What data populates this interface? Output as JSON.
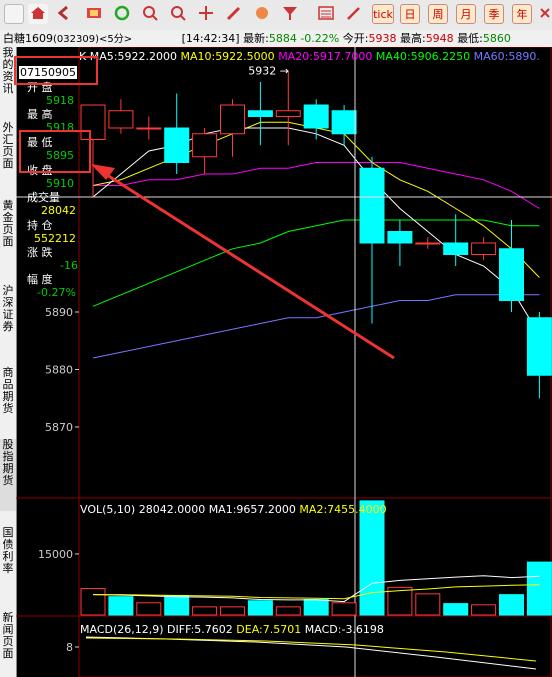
{
  "toolbar": {
    "icons": [
      "home-icon",
      "back-icon",
      "forward-icon",
      "video-icon",
      "refresh-icon",
      "zoom-in-icon",
      "zoom-out-icon",
      "crosshair-icon",
      "pen-icon",
      "pie-icon",
      "filter-icon",
      "list-icon",
      "draw-icon",
      "vol-icon",
      "f10-icon",
      "tick-icon"
    ],
    "tabs": [
      "日",
      "周",
      "月",
      "季",
      "年"
    ]
  },
  "infobar": {
    "symbol": "白糖1609",
    "code": "(032309)",
    "period": "<5分>",
    "time": "[14:42:34]",
    "last_label": "最新:",
    "last_value": "5884",
    "change": "-0.22%",
    "open_label": "今开:",
    "open_value": "5938",
    "high_label": "最高:",
    "high_value": "5948",
    "low_label": "最低:",
    "low_value": "5860"
  },
  "sidebar": {
    "tabs": [
      "我的资讯",
      "外汇页面",
      "黄金页面",
      "沪深证券",
      "商品期货",
      "股指期货",
      "国债利率",
      "新闻页面"
    ]
  },
  "info_panel": {
    "date": "07150905",
    "rows": [
      {
        "name": "开 盘",
        "value": "5918"
      },
      {
        "name": "最 高",
        "value": "5918"
      },
      {
        "name": "最 低",
        "value": "5895"
      },
      {
        "name": "收 盘",
        "value": "5910"
      },
      {
        "name": "成交量",
        "value": "28042"
      },
      {
        "name": "持 仓",
        "value": "552212"
      },
      {
        "name": "涨 跌",
        "value": "-16"
      },
      {
        "name": "幅 度",
        "value": "-0.27%"
      }
    ]
  },
  "chart_data": [
    {
      "type": "candlestick",
      "title": "K",
      "legend": [
        {
          "name": "MA5",
          "value": "5922.2000",
          "color": "#ffffff"
        },
        {
          "name": "MA10",
          "value": "5922.5000",
          "color": "#ffff00"
        },
        {
          "name": "MA20",
          "value": "5917.7000",
          "color": "#ff00ff"
        },
        {
          "name": "MA40",
          "value": "5906.2250",
          "color": "#00ff00"
        },
        {
          "name": "MA60",
          "value": "5890.",
          "color": "#7777ff"
        }
      ],
      "ylim": [
        5855,
        5948
      ],
      "yticks": [
        5870,
        5880,
        5890
      ],
      "peak_label": "5932",
      "candles": [
        {
          "o": 5920,
          "c": 5926,
          "h": 5926,
          "l": 5910
        },
        {
          "o": 5922,
          "c": 5925,
          "h": 5927,
          "l": 5921
        },
        {
          "o": 5922,
          "c": 5922,
          "h": 5924,
          "l": 5920
        },
        {
          "o": 5922,
          "c": 5916,
          "h": 5928,
          "l": 5914
        },
        {
          "o": 5917,
          "c": 5921,
          "h": 5922,
          "l": 5914
        },
        {
          "o": 5921,
          "c": 5926,
          "h": 5927,
          "l": 5917
        },
        {
          "o": 5925,
          "c": 5924,
          "h": 5930,
          "l": 5919
        },
        {
          "o": 5924,
          "c": 5925,
          "h": 5932,
          "l": 5919
        },
        {
          "o": 5926,
          "c": 5922,
          "h": 5927,
          "l": 5920
        },
        {
          "o": 5925,
          "c": 5921,
          "h": 5926,
          "l": 5919
        },
        {
          "o": 5915,
          "c": 5902,
          "h": 5917,
          "l": 5888
        },
        {
          "o": 5904,
          "c": 5902,
          "h": 5906,
          "l": 5898
        },
        {
          "o": 5902,
          "c": 5902,
          "h": 5903,
          "l": 5901
        },
        {
          "o": 5902,
          "c": 5900,
          "h": 5907,
          "l": 5898
        },
        {
          "o": 5900,
          "c": 5902,
          "h": 5903,
          "l": 5899
        },
        {
          "o": 5901,
          "c": 5892,
          "h": 5906,
          "l": 5890
        },
        {
          "o": 5889,
          "c": 5879,
          "h": 5890,
          "l": 5875
        }
      ],
      "ma5": [
        5910,
        5914,
        5918,
        5919,
        5921,
        5922,
        5922,
        5922,
        5921,
        5919,
        5913,
        5908,
        5904,
        5900,
        5898,
        5894,
        5886
      ],
      "ma10": [
        5912,
        5913,
        5915,
        5917,
        5919,
        5921,
        5923,
        5923,
        5922,
        5921,
        5916,
        5913,
        5911,
        5908,
        5905,
        5901,
        5896
      ],
      "ma20": [
        5912,
        5912,
        5913,
        5913,
        5914,
        5914,
        5915,
        5915,
        5916,
        5916,
        5916,
        5916,
        5915,
        5914,
        5913,
        5911,
        5908
      ],
      "ma40": [
        5891,
        5893,
        5895,
        5897,
        5899,
        5901,
        5902,
        5904,
        5905,
        5906,
        5906,
        5906,
        5906,
        5906,
        5906,
        5905,
        5905
      ],
      "ma60": [
        5882,
        5883,
        5884,
        5885,
        5886,
        5887,
        5888,
        5889,
        5889,
        5890,
        5891,
        5892,
        5892,
        5893,
        5893,
        5893,
        5893
      ]
    },
    {
      "type": "bar",
      "title": "VOL(5,10)",
      "legend": [
        {
          "name": "VOL(5,10)",
          "value": "28042.0000",
          "color": "#ffffff"
        },
        {
          "name": "MA1",
          "value": "9657.2000",
          "color": "#ffffff"
        },
        {
          "name": "MA2",
          "value": "7455.4000",
          "color": "#ffff00"
        }
      ],
      "ylim": [
        0,
        28500
      ],
      "yticks": [
        15000
      ],
      "values": [
        6500,
        4500,
        3000,
        4800,
        2000,
        2000,
        3500,
        2000,
        3800,
        3000,
        28042,
        6800,
        5200,
        2800,
        2500,
        5000,
        13000
      ],
      "up": [
        true,
        false,
        true,
        false,
        true,
        true,
        false,
        true,
        false,
        true,
        false,
        true,
        true,
        false,
        true,
        false,
        false
      ],
      "ma1": [
        5000,
        4900,
        4700,
        4500,
        4400,
        4200,
        3800,
        3700,
        3700,
        3300,
        7800,
        8500,
        8900,
        9300,
        9657,
        9200,
        9500
      ],
      "ma2": [
        5000,
        5000,
        4900,
        4800,
        4700,
        4600,
        4300,
        4200,
        4100,
        4000,
        5500,
        6000,
        6400,
        6900,
        7100,
        7300,
        7455
      ]
    },
    {
      "type": "line",
      "title": "MACD(26,12,9)",
      "legend": [
        {
          "name": "MACD(26,12,9)",
          "value": "",
          "color": "#ffffff"
        },
        {
          "name": "DIFF",
          "value": "5.7602",
          "color": "#ffffff"
        },
        {
          "name": "DEA",
          "value": "7.5701",
          "color": "#ffff00"
        },
        {
          "name": "MACD",
          "value": "-3.6198",
          "color": "#ffffff"
        }
      ],
      "yticks": [
        8
      ]
    }
  ],
  "colors": {
    "up": "#ff3a3a",
    "down": "#00ffff",
    "grid": "#8a0000",
    "axis_text": "#cccccc",
    "ma5": "#ffffff",
    "ma10": "#ffff00",
    "ma20": "#ff00ff",
    "ma40": "#00ff00",
    "ma60": "#7777ff"
  }
}
